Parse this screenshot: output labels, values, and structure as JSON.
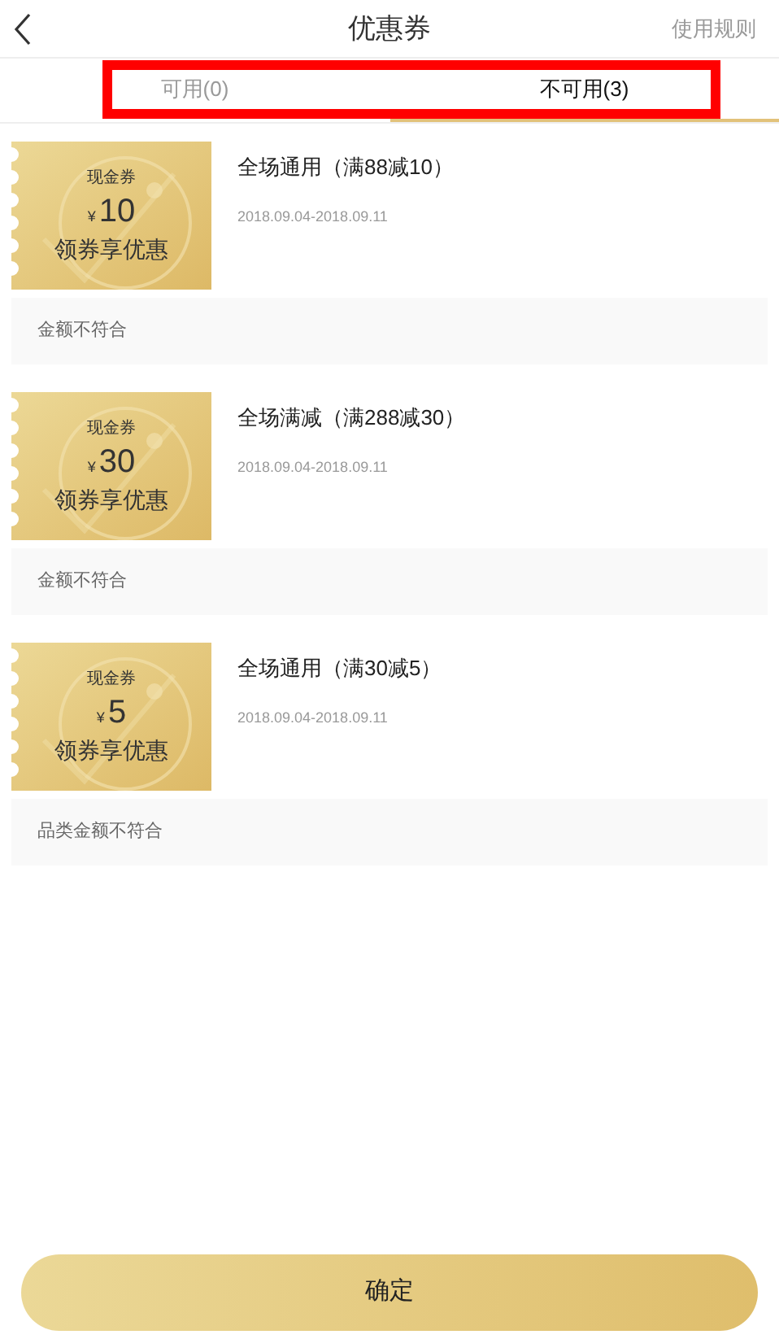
{
  "header": {
    "title": "优惠券",
    "rules_link": "使用规则"
  },
  "tabs": [
    {
      "label": "可用(0)",
      "selected": false
    },
    {
      "label": "不可用(3)",
      "selected": true
    }
  ],
  "coupons": [
    {
      "ticket_type": "现金券",
      "currency": "¥",
      "amount": "10",
      "slogan": "领券享优惠",
      "title": "全场通用（满88减10）",
      "validity": "2018.09.04-2018.09.11",
      "reason": "金额不符合"
    },
    {
      "ticket_type": "现金券",
      "currency": "¥",
      "amount": "30",
      "slogan": "领券享优惠",
      "title": "全场满减（满288减30）",
      "validity": "2018.09.04-2018.09.11",
      "reason": "金额不符合"
    },
    {
      "ticket_type": "现金券",
      "currency": "¥",
      "amount": "5",
      "slogan": "领券享优惠",
      "title": "全场通用（满30减5）",
      "validity": "2018.09.04-2018.09.11",
      "reason": "品类金额不符合"
    }
  ],
  "confirm_button": "确定"
}
